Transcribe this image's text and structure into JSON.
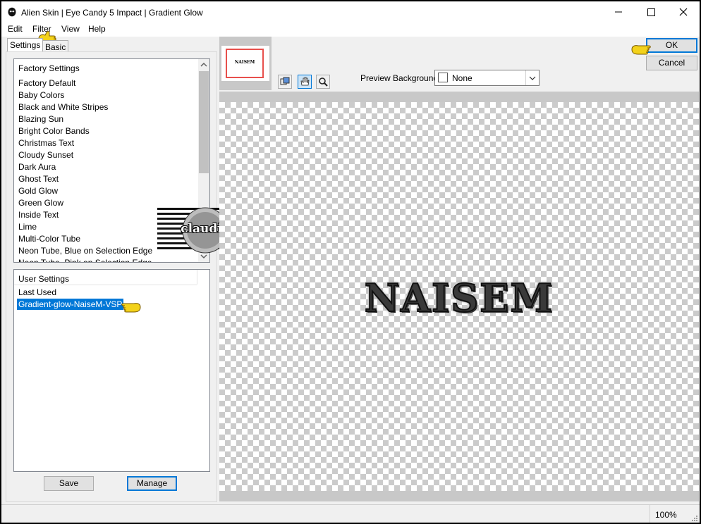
{
  "window": {
    "title": "Alien Skin | Eye Candy 5 Impact | Gradient Glow"
  },
  "menu": {
    "items": [
      "Edit",
      "Filter",
      "View",
      "Help"
    ]
  },
  "tabs": {
    "settings": "Settings",
    "basic": "Basic"
  },
  "factory": {
    "header": "Factory Settings",
    "items": [
      "Factory Default",
      "Baby Colors",
      "Black and White Stripes",
      "Blazing Sun",
      "Bright Color Bands",
      "Christmas Text",
      "Cloudy Sunset",
      "Dark Aura",
      "Ghost Text",
      "Gold Glow",
      "Green Glow",
      "Inside Text",
      "Lime",
      "Multi-Color Tube",
      "Neon Tube, Blue on Selection Edge",
      "Neon Tube, Pink on Selection Edge"
    ]
  },
  "user": {
    "header": "User Settings",
    "items": [
      "Last Used",
      "Gradient-glow-NaiseM-VSP"
    ],
    "selected_index": 1
  },
  "buttons": {
    "save": "Save",
    "manage": "Manage",
    "ok": "OK",
    "cancel": "Cancel"
  },
  "preview": {
    "background_label": "Preview Background:",
    "background_value": "None",
    "thumbnail_text": "NAISEM",
    "text": "NAISEM"
  },
  "watermark": {
    "text": "claudia"
  },
  "status": {
    "zoom": "100%"
  },
  "colors": {
    "selection": "#0078d7",
    "thumbnail_frame": "#e8504c",
    "pointer_hand": "#f3d21b"
  }
}
